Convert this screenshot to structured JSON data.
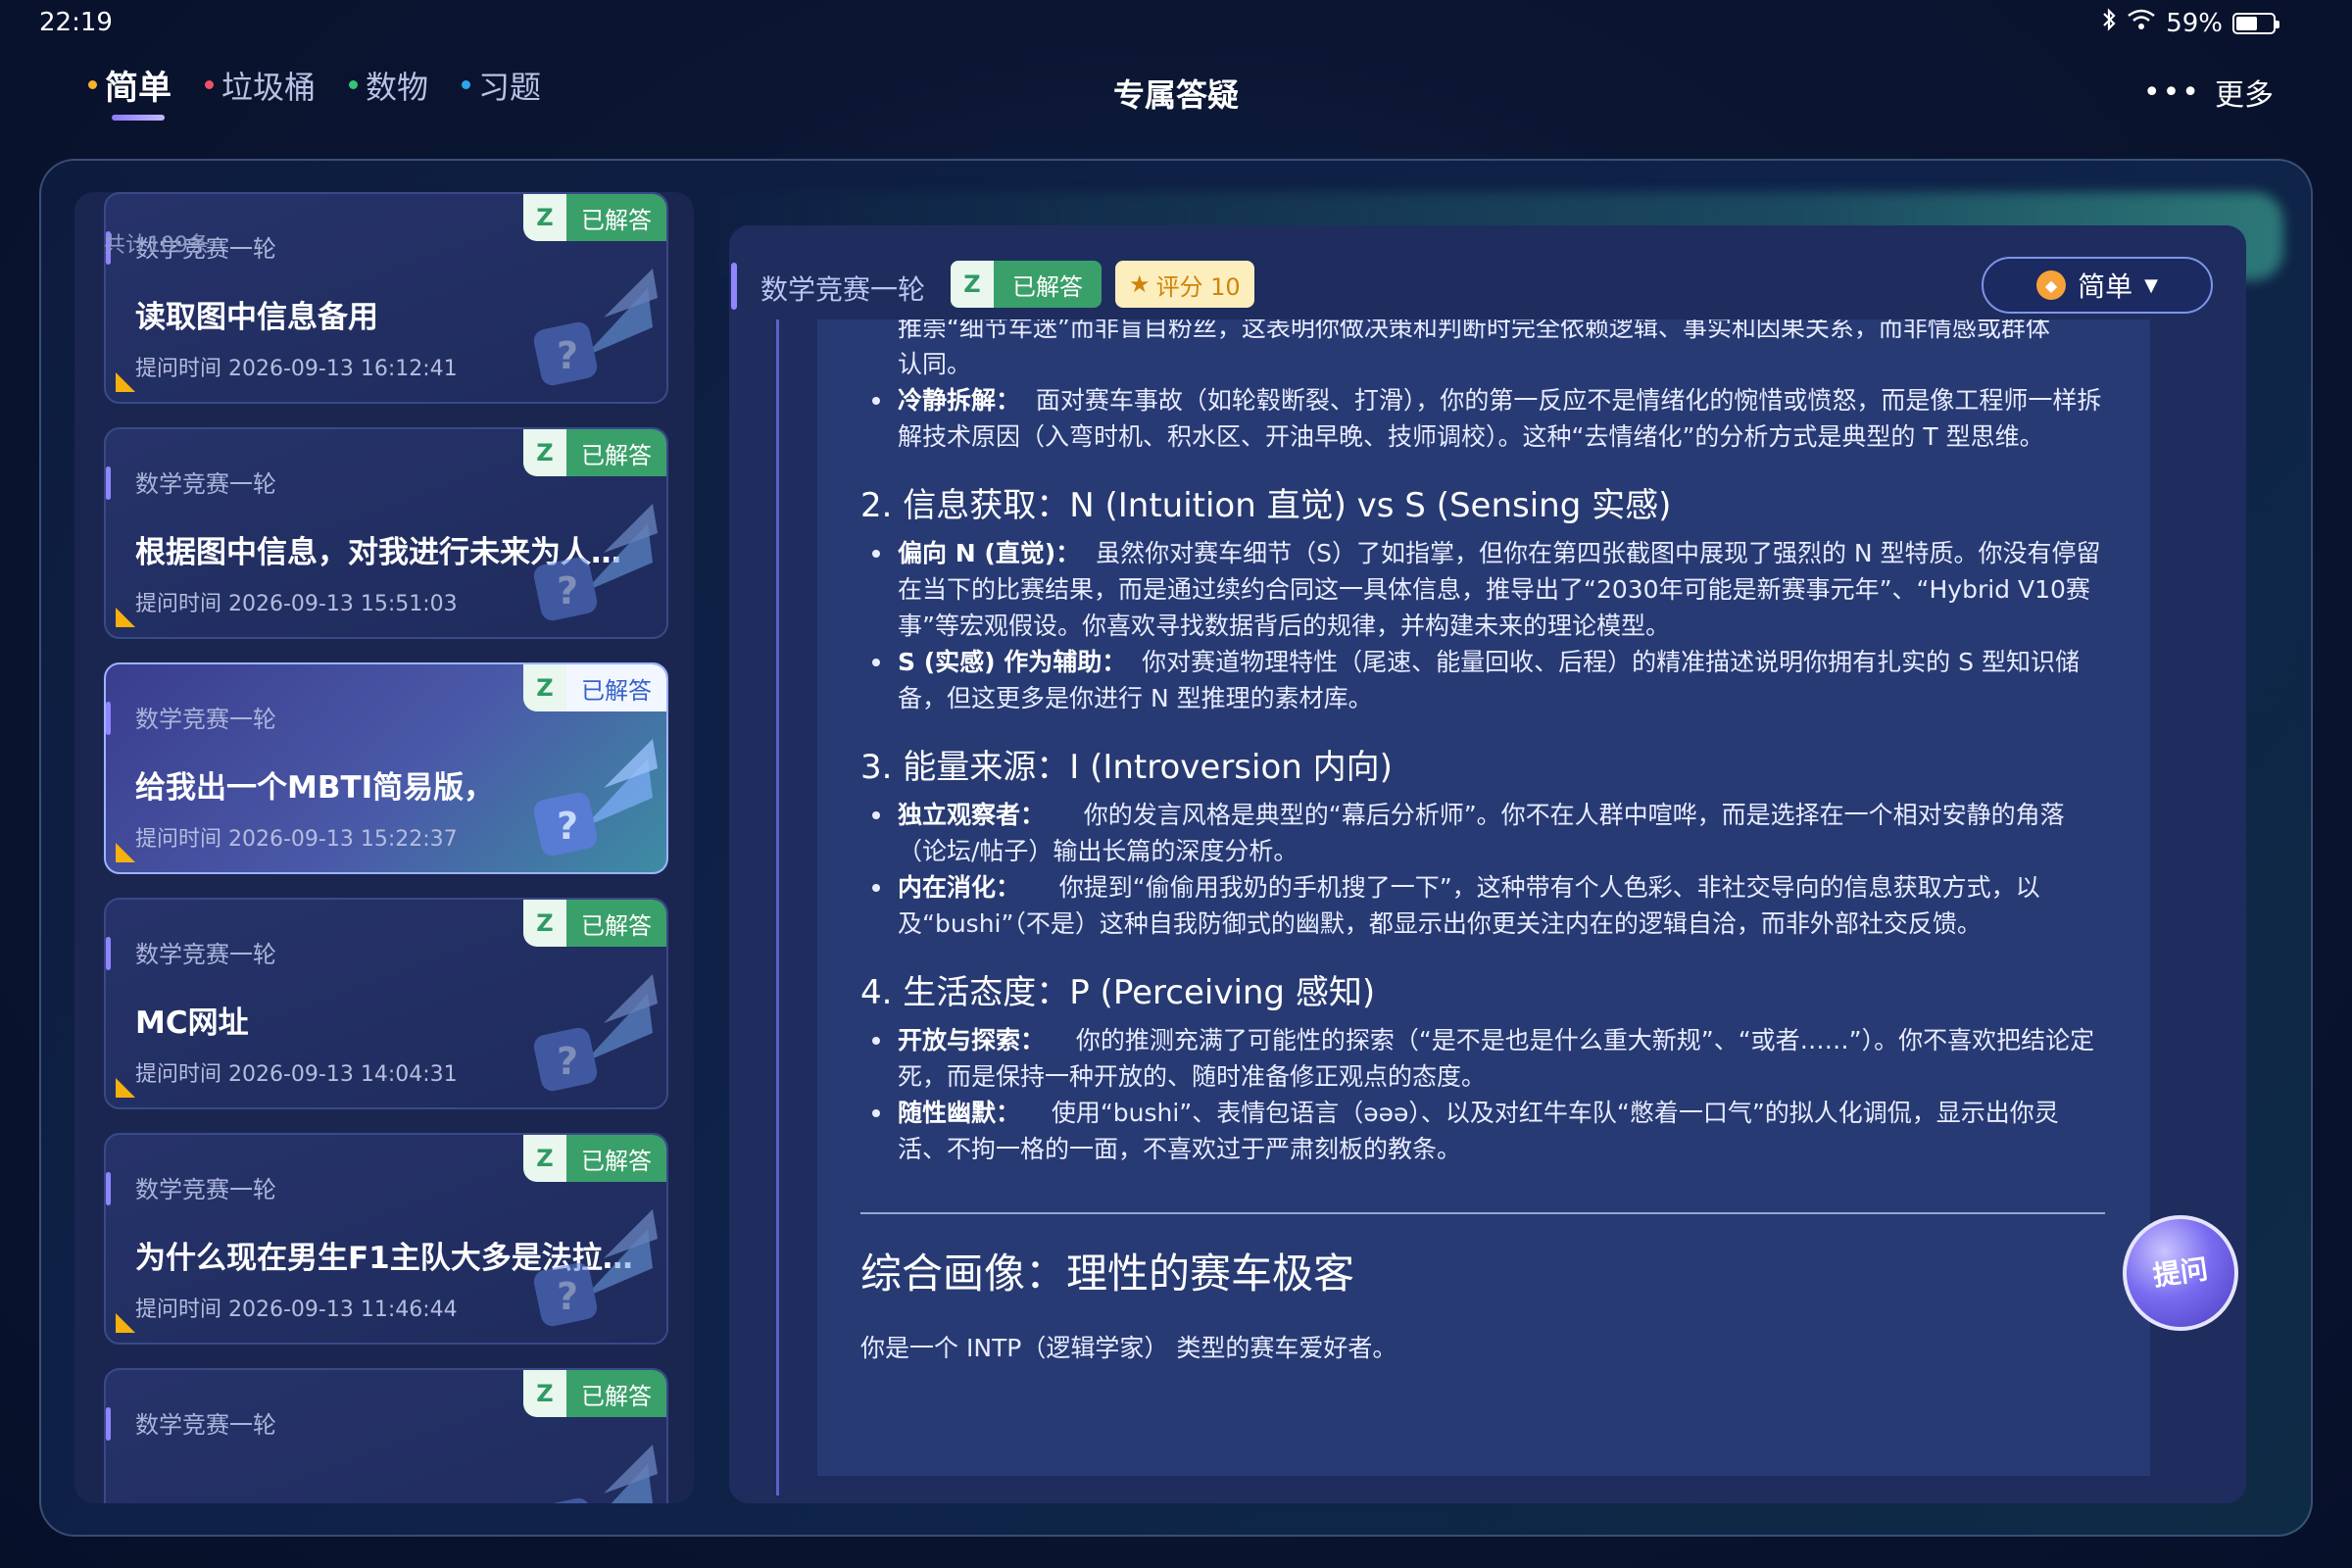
{
  "status_bar": {
    "time": "22:19",
    "battery": "59%",
    "battery_level": 0.59
  },
  "top_nav": {
    "tabs": [
      {
        "label": "简单",
        "dot_color": "#f5b22a",
        "active": true
      },
      {
        "label": "垃圾桶",
        "dot_color": "#f0506a",
        "active": false
      },
      {
        "label": "数物",
        "dot_color": "#35c474",
        "active": false
      },
      {
        "label": "习题",
        "dot_color": "#2da6f0",
        "active": false
      }
    ],
    "title": "专属答疑",
    "more_label": "更多"
  },
  "left_panel": {
    "count_label": "共计109条",
    "cards": [
      {
        "category": "数学竞赛一轮",
        "title": "读取图中信息备用",
        "time": "提问时间 2026-09-13 16:12:41",
        "badge_z": "Z",
        "badge_text": "已解答",
        "active": false
      },
      {
        "category": "数学竞赛一轮",
        "title": "根据图中信息，对我进行未来为人规划",
        "time": "提问时间 2026-09-13 15:51:03",
        "badge_z": "Z",
        "badge_text": "已解答",
        "active": false
      },
      {
        "category": "数学竞赛一轮",
        "title": "给我出一个MBTI简易版，",
        "time": "提问时间 2026-09-13 15:22:37",
        "badge_z": "Z",
        "badge_text": "已解答",
        "active": true
      },
      {
        "category": "数学竞赛一轮",
        "title": "MC网址",
        "time": "提问时间 2026-09-13 14:04:31",
        "badge_z": "Z",
        "badge_text": "已解答",
        "active": false
      },
      {
        "category": "数学竞赛一轮",
        "title": "为什么现在男生F1主队大多是法拉利…",
        "time": "提问时间 2026-09-13 11:46:44",
        "badge_z": "Z",
        "badge_text": "已解答",
        "active": false
      },
      {
        "category": "数学竞赛一轮",
        "title": "",
        "time": "",
        "badge_z": "Z",
        "badge_text": "已解答",
        "active": false
      }
    ]
  },
  "detail": {
    "category": "数学竞赛一轮",
    "status_z": "Z",
    "status_text": "已解答",
    "score_label": "评分 10",
    "level_label": "简单",
    "answer": {
      "intro_line1": "推崇“细节车迷”而非盲目粉丝，这表明你做决策和判断时完全依赖逻辑、事实和因果关系，而非情感或群体",
      "intro_line2": "认同。",
      "intro_bullet_label": "冷静拆解：",
      "intro_bullet_text": "面对赛车事故（如轮毂断裂、打滑），你的第一反应不是情绪化的惋惜或愤怒，而是像工程师一样拆解技术原因（入弯时机、积水区、开油早晚、技师调校）。这种“去情绪化”的分析方式是典型的 T 型思维。",
      "s2_title": "2. 信息获取：N (Intuition 直觉) vs S (Sensing 实感)",
      "s2_b1_label": "偏向 N (直觉)：",
      "s2_b1_text": "虽然你对赛车细节（S）了如指掌，但你在第四张截图中展现了强烈的 N 型特质。你没有停留在当下的比赛结果，而是通过续约合同这一具体信息，推导出了“2030年可能是新赛事元年”、“Hybrid V10赛事”等宏观假设。你喜欢寻找数据背后的规律，并构建未来的理论模型。",
      "s2_b2_label": "S (实感) 作为辅助：",
      "s2_b2_text": "你对赛道物理特性（尾速、能量回收、后程）的精准描述说明你拥有扎实的 S 型知识储备，但这更多是你进行 N 型推理的素材库。",
      "s3_title": "3. 能量来源：I (Introversion 内向)",
      "s3_b1_label": "独立观察者：",
      "s3_b1_text": "你的发言风格是典型的“幕后分析师”。你不在人群中喧哗，而是选择在一个相对安静的角落（论坛/帖子）输出长篇的深度分析。",
      "s3_b2_label": "内在消化：",
      "s3_b2_text": "你提到“偷偷用我奶的手机搜了一下”，这种带有个人色彩、非社交导向的信息获取方式，以及“bushi”（不是）这种自我防御式的幽默，都显示出你更关注内在的逻辑自洽，而非外部社交反馈。",
      "s4_title": "4. 生活态度：P (Perceiving 感知)",
      "s4_b1_label": "开放与探索：",
      "s4_b1_text": "你的推测充满了可能性的探索（“是不是也是什么重大新规”、“或者……”）。你不喜欢把结论定死，而是保持一种开放的、随时准备修正观点的态度。",
      "s4_b2_label": "随性幽默：",
      "s4_b2_text": "使用“bushi”、表情包语言（ǝǝǝ）、以及对红牛车队“憋着一口气”的拟人化调侃，显示出你灵活、不拘一格的一面，不喜欢过于严肃刻板的教条。",
      "summary_title": "综合画像：理性的赛车极客",
      "summary_text": "你是一个 INTP（逻辑学家） 类型的赛车爱好者。"
    }
  },
  "fab_label": "提问"
}
